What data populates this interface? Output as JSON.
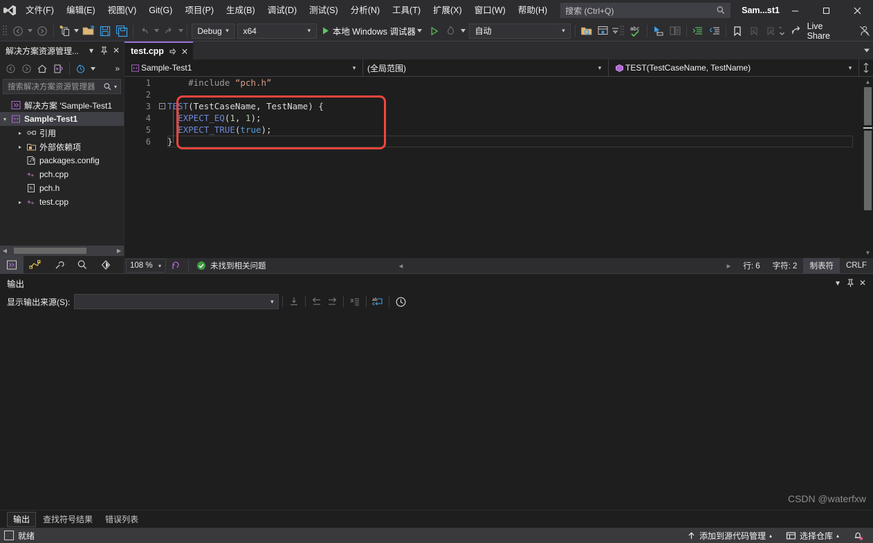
{
  "titlebar": {
    "logo": "visual-studio-logo",
    "menus": [
      {
        "label": "文件(F)"
      },
      {
        "label": "编辑(E)"
      },
      {
        "label": "视图(V)"
      },
      {
        "label": "Git(G)"
      },
      {
        "label": "项目(P)"
      },
      {
        "label": "生成(B)"
      },
      {
        "label": "调试(D)"
      },
      {
        "label": "测试(S)"
      },
      {
        "label": "分析(N)"
      },
      {
        "label": "工具(T)"
      },
      {
        "label": "扩展(X)"
      },
      {
        "label": "窗口(W)"
      },
      {
        "label": "帮助(H)"
      }
    ],
    "search": {
      "placeholder": "搜索 (Ctrl+Q)",
      "text": "搜索",
      "shortcut": "(Ctrl+Q)",
      "icon": "search-icon"
    },
    "solution_name": "Sam...st1",
    "window_buttons": {
      "minimize": "—",
      "maximize": "☐",
      "close": "✕"
    }
  },
  "toolbar": {
    "nav_back": "back-arrow-icon",
    "nav_forward": "forward-arrow-icon",
    "new_item": "new-item-icon",
    "open_file": "open-file-icon",
    "save": "save-icon",
    "save_all": "save-all-icon",
    "undo": "undo-icon",
    "redo": "redo-icon",
    "configuration": {
      "value": "Debug",
      "arrow": "▾"
    },
    "platform": {
      "value": "x64",
      "arrow": "▾"
    },
    "start_debug": {
      "label": "本地 Windows 调试器",
      "icon": "play-icon",
      "arrow": "▾"
    },
    "start_no_debug": "play-outline-icon",
    "process": {
      "value": "自动",
      "arrow": "▾"
    },
    "live_share": {
      "label": "Live Share",
      "icon": "live-share-icon"
    }
  },
  "solution_explorer": {
    "title": "解决方案资源管理...",
    "dropdown": "▾",
    "pin": "pin-icon",
    "close": "✕",
    "toolbar_icons": [
      "back-icon",
      "forward-icon",
      "home-icon",
      "sync-with-active-document-icon",
      "show-all-files-icon"
    ],
    "overflow": "»",
    "search": {
      "placeholder": "搜索解决方案资源管理器",
      "arrow": "▾",
      "icon": "search-icon"
    },
    "tree": [
      {
        "label": "解决方案 'Sample-Test1",
        "icon": "solution-icon",
        "twisty": "",
        "indent": 0,
        "bold": false,
        "selected": false
      },
      {
        "label": "Sample-Test1",
        "icon": "cpp-project-icon",
        "twisty": "▾",
        "indent": 0,
        "bold": true,
        "selected": true
      },
      {
        "label": "引用",
        "icon": "references-icon",
        "twisty": "▸",
        "indent": 1,
        "bold": false,
        "selected": false
      },
      {
        "label": "外部依赖项",
        "icon": "external-deps-icon",
        "twisty": "▸",
        "indent": 1,
        "bold": false,
        "selected": false
      },
      {
        "label": "packages.config",
        "icon": "config-file-icon",
        "twisty": "",
        "indent": 1,
        "bold": false,
        "selected": false
      },
      {
        "label": "pch.cpp",
        "icon": "cpp-file-icon",
        "twisty": "",
        "indent": 1,
        "bold": false,
        "selected": false
      },
      {
        "label": "pch.h",
        "icon": "header-file-icon",
        "twisty": "",
        "indent": 1,
        "bold": false,
        "selected": false
      },
      {
        "label": "test.cpp",
        "icon": "cpp-file-icon",
        "twisty": "▸",
        "indent": 1,
        "bold": false,
        "selected": false
      }
    ],
    "bottom_tabs": [
      {
        "name": "solution-explorer-tab",
        "icon": "solution-explorer-icon",
        "active": true
      },
      {
        "name": "git-changes-tab",
        "icon": "git-changes-icon",
        "active": false
      },
      {
        "name": "properties-tab",
        "icon": "wrench-icon",
        "active": false
      },
      {
        "name": "search-tab",
        "icon": "magnifier-icon",
        "active": false
      },
      {
        "name": "class-view-tab",
        "icon": "diamond-icon",
        "active": false
      }
    ]
  },
  "editor": {
    "tab": {
      "label": "test.cpp",
      "pin": "pin-icon",
      "close": "✕"
    },
    "navbar": {
      "project": {
        "value": "Sample-Test1",
        "icon": "cpp-project-icon",
        "arrow": "▾"
      },
      "scope": {
        "value": "(全局范围)",
        "arrow": "▾"
      },
      "member": {
        "value": "TEST(TestCaseName, TestName)",
        "icon": "macro-icon",
        "arrow": "▾"
      },
      "split": "split-view-icon"
    },
    "lines": [
      {
        "number": "1",
        "fold": "",
        "tokens": [
          {
            "text": "    ",
            "cls": "k-plain"
          },
          {
            "text": "#include",
            "cls": "k-pre"
          },
          {
            "text": " ",
            "cls": "k-plain"
          },
          {
            "text": "\"pch.h\"",
            "cls": "k-str"
          }
        ]
      },
      {
        "number": "2",
        "fold": "",
        "tokens": []
      },
      {
        "number": "3",
        "fold": "-",
        "tokens": [
          {
            "text": "TEST",
            "cls": "k-macro"
          },
          {
            "text": "(TestCaseName, TestName) {",
            "cls": "k-punc"
          }
        ]
      },
      {
        "number": "4",
        "fold": "",
        "tokens": [
          {
            "text": "  ",
            "cls": "k-plain"
          },
          {
            "text": "EXPECT_EQ",
            "cls": "k-macro"
          },
          {
            "text": "(",
            "cls": "k-punc"
          },
          {
            "text": "1",
            "cls": "k-num"
          },
          {
            "text": ", ",
            "cls": "k-punc"
          },
          {
            "text": "1",
            "cls": "k-num"
          },
          {
            "text": ");",
            "cls": "k-punc"
          }
        ]
      },
      {
        "number": "5",
        "fold": "",
        "tokens": [
          {
            "text": "  ",
            "cls": "k-plain"
          },
          {
            "text": "EXPECT_TRUE",
            "cls": "k-macro"
          },
          {
            "text": "(",
            "cls": "k-punc"
          },
          {
            "text": "true",
            "cls": "k-kw"
          },
          {
            "text": ");",
            "cls": "k-punc"
          }
        ]
      },
      {
        "number": "6",
        "fold": "",
        "tokens": [
          {
            "text": "}",
            "cls": "k-punc"
          }
        ]
      }
    ],
    "annotation": {
      "shape": "rounded-rectangle",
      "color": "#f2453d"
    },
    "status": {
      "zoom": "108 %",
      "zoom_arrow": "▾",
      "intellisense_icon": "intellisense-icon",
      "issue_icon": "check-circle-icon",
      "issue_text": "未找到相关问题",
      "scroll_arrow": "◂",
      "expand_arrow": "▸",
      "line": "行: 6",
      "column": "字符: 2",
      "indent": "制表符",
      "eol": "CRLF"
    }
  },
  "output_pane": {
    "title": "输出",
    "dropdown": "▾",
    "pin": "pin-icon",
    "close": "✕",
    "source_label": "显示输出来源(S):",
    "source_value": "",
    "source_arrow": "▾",
    "toolbar_icons": [
      "jump-to-output-icon",
      "go-to-previous-icon",
      "go-to-next-icon",
      "clear-all-icon",
      "toggle-word-wrap-icon",
      "show-timestamps-icon"
    ],
    "watermark": "CSDN @waterfxw",
    "tabs": [
      {
        "label": "输出",
        "active": true
      },
      {
        "label": "查找符号结果",
        "active": false
      },
      {
        "label": "错误列表",
        "active": false
      }
    ]
  },
  "statusbar": {
    "ready": "就绪",
    "source_control": {
      "label": "添加到源代码管理",
      "icon": "up-arrow-icon",
      "arrow": "▴"
    },
    "repository": {
      "label": "选择仓库",
      "icon": "repo-icon",
      "arrow": "▴"
    },
    "notifications": "bell-icon"
  },
  "colors": {
    "accent_purple": "#9b70d8",
    "annotation_red": "#f2453d",
    "chrome_bg": "#2d2d30",
    "editor_bg": "#1e1e1e",
    "panel_bg": "#252526",
    "status_bg": "#3a3a3c",
    "macro_blue": "#6e8ad6",
    "keyword_blue": "#569cd6",
    "string_orange": "#d69d85"
  }
}
